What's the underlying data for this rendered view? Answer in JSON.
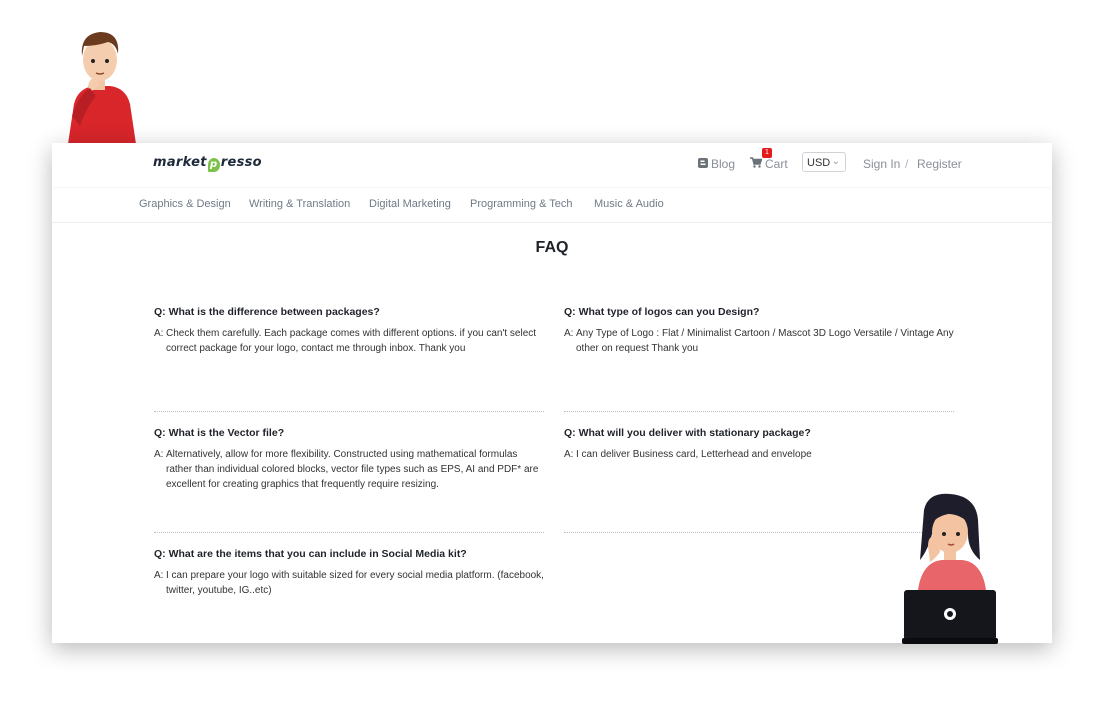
{
  "header": {
    "logo_left": "market",
    "logo_p": "p",
    "logo_right": "resso",
    "blog_label": "Blog",
    "cart_label": "Cart",
    "cart_count": "1",
    "currency": "USD",
    "signin_label": "Sign In",
    "separator": "/",
    "register_label": "Register"
  },
  "categories": [
    "Graphics & Design",
    "Writing & Translation",
    "Digital Marketing",
    "Programming & Tech",
    "Music & Audio"
  ],
  "faq": {
    "title": "FAQ",
    "items": [
      {
        "q": "Q: What is the difference between packages?",
        "a_prefix": "A:",
        "a": "Check them carefully. Each package comes with different options. if you can't select correct package for your logo, contact me through inbox. Thank you"
      },
      {
        "q": "Q: What type of logos can you Design?",
        "a_prefix": "A:",
        "a": "Any Type of Logo : Flat / Minimalist Cartoon / Mascot 3D Logo Versatile / Vintage Any other on request Thank you"
      },
      {
        "q": "Q: What is the Vector file?",
        "a_prefix": "A:",
        "a": "Alternatively, allow for more flexibility. Constructed using mathematical formulas rather than individual colored blocks, vector file types such as EPS, AI and PDF* are excellent for creating graphics that frequently require resizing."
      },
      {
        "q": "Q: What will you deliver with stationary package?",
        "a_prefix": "A:",
        "a": "I can deliver Business card, Letterhead and envelope"
      },
      {
        "q": "Q: What are the items that you can include in Social Media kit?",
        "a_prefix": "A:",
        "a": "I can prepare your logo with suitable sized for every social media platform. (facebook, twitter, youtube, IG..etc)"
      }
    ]
  },
  "icons": {
    "blog": "blogger-icon",
    "cart": "cart-icon",
    "currency_chevron": "chevron-down-icon"
  }
}
